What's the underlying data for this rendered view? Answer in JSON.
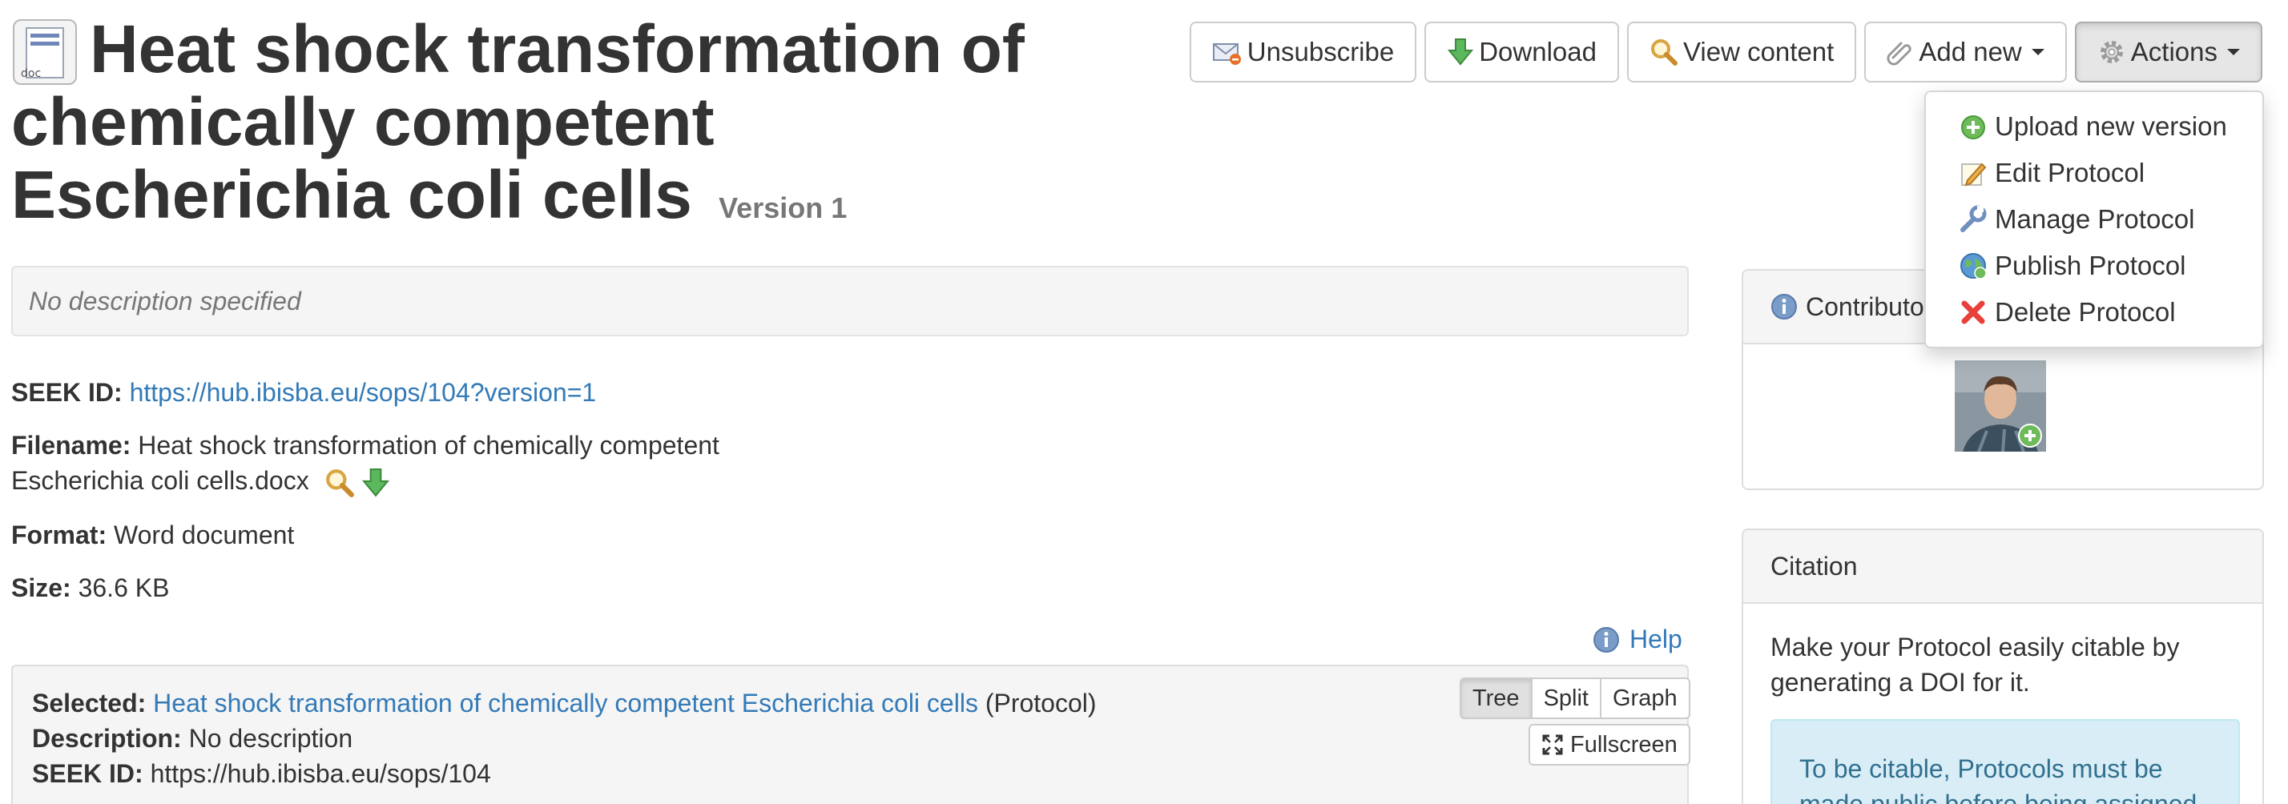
{
  "header": {
    "title": "Heat shock transformation of chemically competent Escherichia coli cells",
    "version": "Version 1",
    "doc_icon_label": "doc"
  },
  "toolbar": {
    "unsubscribe": "Unsubscribe",
    "download": "Download",
    "view_content": "View content",
    "add_new": "Add new",
    "actions": "Actions"
  },
  "actions_menu": {
    "items": [
      {
        "label": "Upload new version",
        "icon": "plus-circle-icon"
      },
      {
        "label": "Edit Protocol",
        "icon": "pencil-icon"
      },
      {
        "label": "Manage Protocol",
        "icon": "wrench-icon"
      },
      {
        "label": "Publish Protocol",
        "icon": "globe-icon"
      },
      {
        "label": "Delete Protocol",
        "icon": "cross-icon"
      }
    ]
  },
  "details": {
    "description": "No description specified",
    "seek_id_label": "SEEK ID:",
    "seek_id_value": "https://hub.ibisba.eu/sops/104?version=1",
    "filename_label": "Filename:",
    "filename_line1": "Heat shock transformation of chemically competent",
    "filename_line2": "Escherichia coli cells.docx",
    "format_label": "Format:",
    "format_value": "Word document",
    "size_label": "Size:",
    "size_value": "36.6 KB",
    "help": "Help"
  },
  "tree_panel": {
    "selected_label": "Selected:",
    "selected_link": "Heat shock transformation of chemically competent Escherichia coli cells",
    "selected_type": "(Protocol)",
    "description_label": "Description:",
    "description_value": "No description",
    "seek_id_label": "SEEK ID:",
    "seek_id_value": "https://hub.ibisba.eu/sops/104",
    "views": [
      "Tree",
      "Split",
      "Graph"
    ],
    "active_view": "Tree",
    "fullscreen": "Fullscreen"
  },
  "sidebar": {
    "contributors_title": "Contributo",
    "citation_title": "Citation",
    "citation_text": "Make your Protocol easily citable by generating a DOI for it.",
    "citation_notice": "To be citable, Protocols must be made public before being assigned"
  },
  "colors": {
    "link": "#337ab7",
    "panel_bg": "#f5f5f5",
    "callout_bg": "#d9edf7",
    "callout_text": "#31708f"
  }
}
